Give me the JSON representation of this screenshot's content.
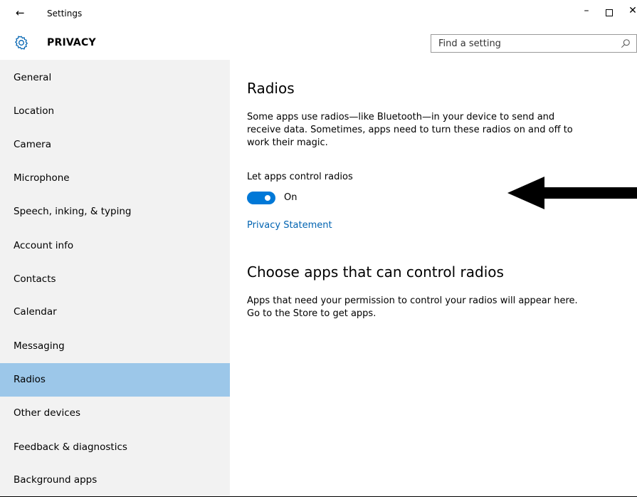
{
  "window": {
    "title": "Settings",
    "back_glyph": "←",
    "minimize_glyph": "–",
    "close_glyph": "✕"
  },
  "header": {
    "section_title": "PRIVACY",
    "search_placeholder": "Find a setting"
  },
  "sidebar": {
    "selected": "Radios",
    "items": [
      {
        "label": "General"
      },
      {
        "label": "Location"
      },
      {
        "label": "Camera"
      },
      {
        "label": "Microphone"
      },
      {
        "label": "Speech, inking, & typing"
      },
      {
        "label": "Account info"
      },
      {
        "label": "Contacts"
      },
      {
        "label": "Calendar"
      },
      {
        "label": "Messaging"
      },
      {
        "label": "Radios"
      },
      {
        "label": "Other devices"
      },
      {
        "label": "Feedback & diagnostics"
      },
      {
        "label": "Background apps"
      }
    ]
  },
  "main": {
    "heading": "Radios",
    "description": "Some apps use radios—like Bluetooth—in your device to send and receive data. Sometimes, apps need to turn these radios on and off to work their magic.",
    "toggle": {
      "label": "Let apps control radios",
      "state": "On",
      "on": true,
      "color": "#0078d7"
    },
    "privacy_link": "Privacy Statement",
    "apps_heading": "Choose apps that can control radios",
    "apps_description": "Apps that need your permission to control your radios will appear here. Go to the Store to get apps."
  },
  "colors": {
    "selected_item": "#9cc7e9",
    "sidebar_bg": "#f2f2f2",
    "link": "#0063b1"
  }
}
